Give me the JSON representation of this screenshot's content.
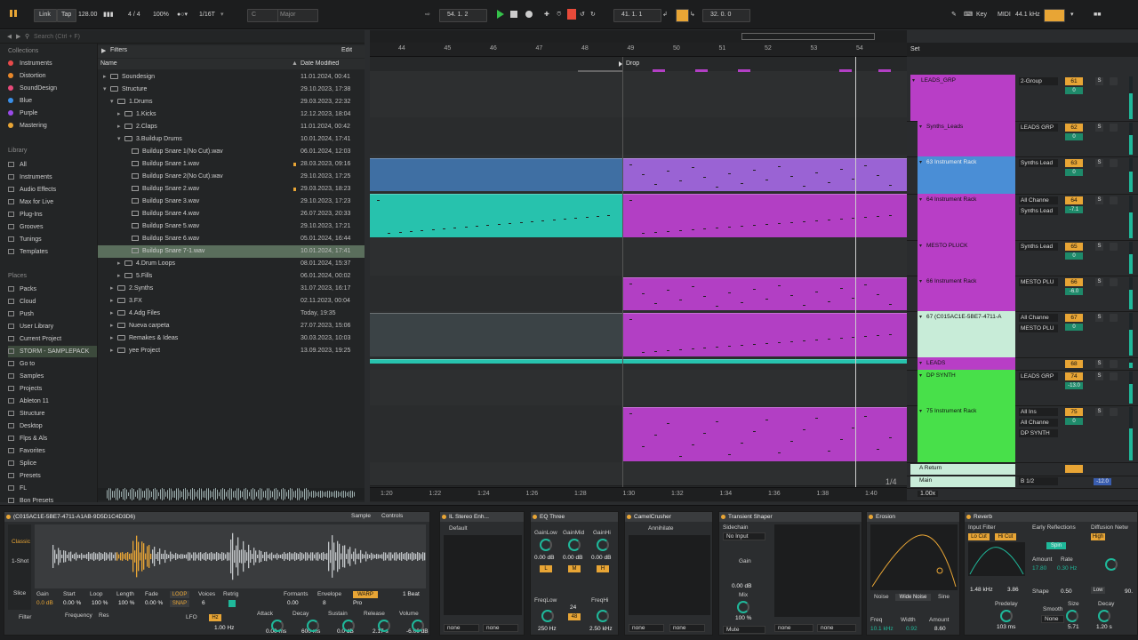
{
  "transport": {
    "link": "Link",
    "tap": "Tap",
    "tempo": "128.00",
    "time_sig": "4 / 4",
    "zoom": "100%",
    "quantize": "1/16T",
    "key_root": "C",
    "scale": "Major",
    "position": "54.  1.  2",
    "loop_start": "41.  1.  1",
    "loop_length": "32.  0.  0",
    "key_label": "Key",
    "midi_label": "MIDI",
    "sample_rate": "44.1 kHz"
  },
  "browser": {
    "search_placeholder": "Search (Ctrl + F)",
    "filters_label": "Filters",
    "edit_label": "Edit",
    "col_name": "Name",
    "col_date": "Date Modified",
    "collections_header": "Collections",
    "collections": [
      {
        "label": "Instruments",
        "color": "#e84a4a"
      },
      {
        "label": "Distortion",
        "color": "#e8872a"
      },
      {
        "label": "SoundDesign",
        "color": "#e84a7a"
      },
      {
        "label": "Blue",
        "color": "#3a8fe8"
      },
      {
        "label": "Purple",
        "color": "#9a4ae8"
      },
      {
        "label": "Mastering",
        "color": "#e8a535"
      }
    ],
    "library_header": "Library",
    "library": [
      "All",
      "Instruments",
      "Audio Effects",
      "Max for Live",
      "Plug-Ins",
      "Grooves",
      "Tunings",
      "Templates"
    ],
    "places_header": "Places",
    "places": [
      "Packs",
      "Cloud",
      "Push",
      "User Library",
      "Current Project",
      "STORM - SAMPLEPACK",
      "Go to",
      "Samples",
      "Projects",
      "Ableton 11",
      "Structure",
      "Desktop",
      "Flps & Als",
      "Favorites",
      "Splice",
      "Presets",
      "FL",
      "Bon Presets"
    ],
    "files": [
      {
        "name": "Soundesign",
        "date": "11.01.2024, 00:41",
        "indent": 0,
        "type": "folder",
        "open": false
      },
      {
        "name": "Structure",
        "date": "29.10.2023, 17:38",
        "indent": 0,
        "type": "folder",
        "open": true
      },
      {
        "name": "1.Drums",
        "date": "29.03.2023, 22:32",
        "indent": 1,
        "type": "folder",
        "open": true
      },
      {
        "name": "1.Kicks",
        "date": "12.12.2023, 18:04",
        "indent": 2,
        "type": "folder",
        "open": false
      },
      {
        "name": "2.Claps",
        "date": "11.01.2024, 00:42",
        "indent": 2,
        "type": "folder",
        "open": false
      },
      {
        "name": "3.Buildup Drums",
        "date": "10.01.2024, 17:41",
        "indent": 2,
        "type": "folder",
        "open": true
      },
      {
        "name": "Buildup Snare 1(No Cut).wav",
        "date": "06.01.2024, 12:03",
        "indent": 3,
        "type": "wav"
      },
      {
        "name": "Buildup Snare 1.wav",
        "date": "28.03.2023, 09:16",
        "indent": 3,
        "type": "wav",
        "marked": true
      },
      {
        "name": "Buildup Snare 2(No Cut).wav",
        "date": "29.10.2023, 17:25",
        "indent": 3,
        "type": "wav"
      },
      {
        "name": "Buildup Snare 2.wav",
        "date": "29.03.2023, 18:23",
        "indent": 3,
        "type": "wav",
        "marked": true
      },
      {
        "name": "Buildup Snare 3.wav",
        "date": "29.10.2023, 17:23",
        "indent": 3,
        "type": "wav"
      },
      {
        "name": "Buildup Snare 4.wav",
        "date": "26.07.2023, 20:33",
        "indent": 3,
        "type": "wav"
      },
      {
        "name": "Buildup Snare 5.wav",
        "date": "29.10.2023, 17:21",
        "indent": 3,
        "type": "wav"
      },
      {
        "name": "Buildup Snare 6.wav",
        "date": "05.01.2024, 16:44",
        "indent": 3,
        "type": "wav"
      },
      {
        "name": "Buildup Snare 7-1.wav",
        "date": "10.01.2024, 17:41",
        "indent": 3,
        "type": "wav",
        "selected": true
      },
      {
        "name": "4.Drum Loops",
        "date": "08.01.2024, 15:37",
        "indent": 2,
        "type": "folder",
        "open": false
      },
      {
        "name": "5.Fills",
        "date": "06.01.2024, 00:02",
        "indent": 2,
        "type": "folder",
        "open": false
      },
      {
        "name": "2.Synths",
        "date": "31.07.2023, 16:17",
        "indent": 1,
        "type": "folder",
        "open": false
      },
      {
        "name": "3.FX",
        "date": "02.11.2023, 00:04",
        "indent": 1,
        "type": "folder",
        "open": false
      },
      {
        "name": "4.Adg Files",
        "date": "Today, 19:35",
        "indent": 1,
        "type": "folder",
        "open": false
      },
      {
        "name": "Nueva carpeta",
        "date": "27.07.2023, 15:06",
        "indent": 1,
        "type": "folder",
        "open": false
      },
      {
        "name": "Remakes & Ideas",
        "date": "30.03.2023, 10:03",
        "indent": 1,
        "type": "folder",
        "open": false
      },
      {
        "name": "yee Project",
        "date": "13.09.2023, 19:25",
        "indent": 1,
        "type": "project",
        "open": false
      }
    ]
  },
  "arrangement": {
    "bar_numbers": [
      "44",
      "45",
      "46",
      "47",
      "48",
      "49",
      "50",
      "51",
      "52",
      "53",
      "54"
    ],
    "locator": "Drop",
    "time_marks": [
      "1:20",
      "1:22",
      "1:24",
      "1:26",
      "1:28",
      "1:30",
      "1:32",
      "1:34",
      "1:36",
      "1:38",
      "1:40"
    ],
    "grid_label": "1/4",
    "set_label": "Set"
  },
  "tracks": [
    {
      "name": "LEADS_GRP",
      "io": "2-Group",
      "num": "61",
      "vol": "0",
      "color": "#b83ec6"
    },
    {
      "name": "Synths_Leads",
      "io": "LEADS GRP",
      "num": "62",
      "vol": "0",
      "color": "#b83ec6"
    },
    {
      "name": "63 Instrument Rack",
      "io": "Synths Lead",
      "num": "63",
      "vol": "0",
      "color": "#4a8ed6"
    },
    {
      "name": "64 Instrument Rack",
      "io": "All Channe",
      "io2": "Synths Lead",
      "num": "64",
      "vol": "-7.1",
      "color": "#b83ec6"
    },
    {
      "name": "MESTO PLUCK",
      "io": "Synths Lead",
      "num": "65",
      "vol": "0",
      "color": "#b83ec6"
    },
    {
      "name": "66 Instrument Rack",
      "io": "MESTO PLU",
      "num": "66",
      "vol": "-6.0",
      "color": "#b83ec6"
    },
    {
      "name": "67 (C015AC1E-5BE7-4711-A",
      "io": "All Channe",
      "io2": "MESTO PLU",
      "num": "67",
      "vol": "0",
      "color": "#c8ecd8"
    },
    {
      "name": "LEADS",
      "io": "",
      "num": "68",
      "vol": "",
      "color": "#b83ec6"
    },
    {
      "name": "DP SYNTH",
      "io": "LEADS GRP",
      "num": "74",
      "vol": "-13.0",
      "color": "#48e04a"
    },
    {
      "name": "75 Instrument Rack",
      "io": "All Ins",
      "io2": "All Channe",
      "io3": "DP SYNTH",
      "num": "75",
      "vol": "0",
      "color": "#48e04a"
    }
  ],
  "returns": {
    "a_return": "A Return",
    "main": "Main",
    "main_io": "B 1/2",
    "main_vol": "-12.0",
    "main_zoom": "1.00x"
  },
  "devices": {
    "sampler_title": "(C015AC1E-5BE7-4711-A1AB-9D5D1C4D3D6)",
    "sample_tab": "Sample",
    "controls_tab": "Controls",
    "mode_classic": "Classic",
    "mode_1shot": "1-Shot",
    "mode_slice": "Slice",
    "gain_label": "Gain",
    "gain_val": "0.0 dB",
    "start_label": "Start",
    "start_val": "0.00 %",
    "loop_label": "Loop",
    "loop_val": "100 %",
    "length_label": "Length",
    "length_val": "100 %",
    "fade_label": "Fade",
    "fade_val": "0.00 %",
    "voices_label": "Voices",
    "voices_val": "6",
    "retrig_label": "Retrig",
    "formants_label": "Formants",
    "formants_val": "0.00",
    "envelope_label": "Envelope",
    "envelope_val": "8",
    "warp_label": "WARP",
    "warp_mode": "Pro",
    "warp_beat": "1 Beat",
    "filter_label": "Filter",
    "frequency_label": "Frequency",
    "res_label": "Res",
    "lfo_label": "LFO",
    "lfo_hz": "Hz",
    "lfo_rate": "1.00 Hz",
    "attack_label": "Attack",
    "attack_val": "0.00 ms",
    "decay_label": "Decay",
    "decay_val": "600 ms",
    "sustain_label": "Sustain",
    "sustain_val": "0.0 dB",
    "release_label": "Release",
    "release_val": "2.17 s",
    "volume_label": "Volume",
    "volume_val": "-6.00 dB",
    "ilstereo_title": "IL Stereo Enh...",
    "default_label": "Default",
    "eq_title": "EQ Three",
    "gainlow_label": "GainLow",
    "gainmid_label": "GainMid",
    "gainhi_label": "GainHi",
    "eq_low": "0.00 dB",
    "eq_mid": "0.00 dB",
    "eq_hi": "0.00 dB",
    "freqlow_label": "FreqLow",
    "freqlow_val": "250 Hz",
    "freqhi_label": "FreqHi",
    "freqhi_val": "2.50 kHz",
    "eq_slope_a": "24",
    "eq_slope_b": "48",
    "camel_title": "CamelCrusher",
    "annihilate_label": "Annihilate",
    "transient_title": "Transient Shaper",
    "sidechain_label": "Sidechain",
    "no_input": "No Input",
    "gain_ts_label": "Gain",
    "gain_ts_val": "0.00 dB",
    "mix_label": "Mix",
    "mix_val": "100 %",
    "mute_label": "Mute",
    "none_label": "none",
    "erosion_title": "Erosion",
    "noise_label": "Noise",
    "wide_noise_label": "Wide Noise",
    "sine_label": "Sine",
    "freq_label": "Freq",
    "freq_val": "10.1 kHz",
    "width_label": "Width",
    "width_val": "0.92",
    "amount_label": "Amount",
    "amount_val": "8.60",
    "reverb_title": "Reverb",
    "input_filter_label": "Input Filter",
    "locut_label": "Lo Cut",
    "hicut_label": "Hi Cut",
    "filter_freq": "1.48 kHz",
    "filter_width": "3.86",
    "early_refl_label": "Early Reflections",
    "spin_label": "Spin",
    "amount_r_label": "Amount",
    "amount_r_val": "17.80",
    "rate_label": "Rate",
    "rate_val": "0.30 Hz",
    "shape_label": "Shape",
    "shape_val": "0.50",
    "diffusion_label": "Diffusion Netw",
    "high_label": "High",
    "low_label": "Low",
    "predelay_label": "Predelay",
    "predelay_val": "103 ms",
    "smooth_label": "Smooth",
    "smooth_val": "None",
    "size_label": "Size",
    "size_val": "5.71",
    "decay_r_label": "Decay",
    "decay_r_val": "1.20 s",
    "diff_val": "90."
  }
}
